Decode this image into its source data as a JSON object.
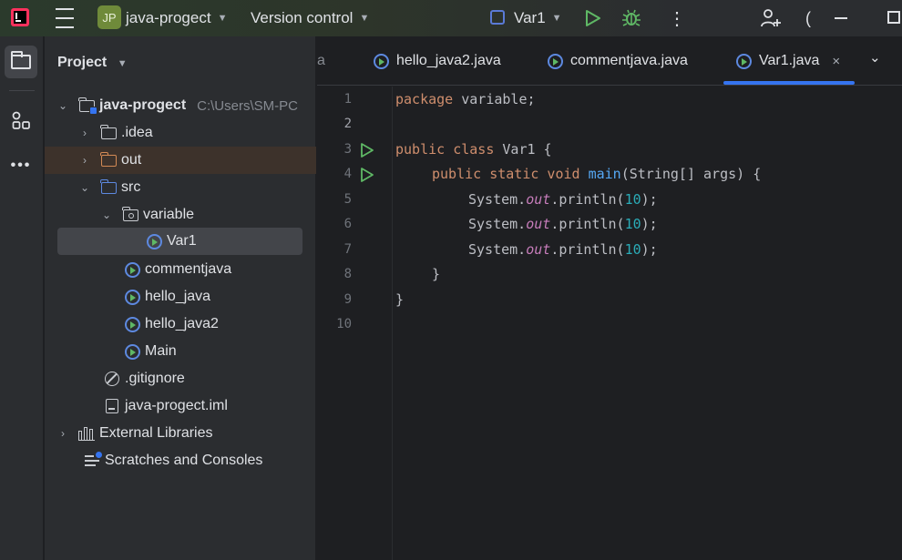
{
  "titlebar": {
    "project_badge": "JP",
    "project_name": "java-progect",
    "vcs_label": "Version control",
    "run_config": "Var1",
    "partial_char": "("
  },
  "project_panel": {
    "title": "Project",
    "tree": [
      {
        "label": "java-progect",
        "hint": "C:\\Users\\SM-PC",
        "arrow": "⌄"
      },
      {
        "label": ".idea",
        "arrow": "›"
      },
      {
        "label": "out",
        "arrow": "›"
      },
      {
        "label": "src",
        "arrow": "⌄"
      },
      {
        "label": "variable",
        "arrow": "⌄"
      },
      {
        "label": "Var1"
      },
      {
        "label": "commentjava"
      },
      {
        "label": "hello_java"
      },
      {
        "label": "hello_java2"
      },
      {
        "label": "Main"
      },
      {
        "label": ".gitignore"
      },
      {
        "label": "java-progect.iml"
      },
      {
        "label": "External Libraries",
        "arrow": "›"
      },
      {
        "label": "Scratches and Consoles"
      }
    ]
  },
  "tabs": {
    "fade_fragment": "a",
    "items": [
      {
        "label": "hello_java2.java"
      },
      {
        "label": "commentjava.java"
      },
      {
        "label": "Var1.java",
        "close": "×"
      }
    ],
    "more": "⌄"
  },
  "editor": {
    "line_numbers": [
      "1",
      "2",
      "3",
      "4",
      "5",
      "6",
      "7",
      "8",
      "9",
      "10"
    ],
    "current_line": 2,
    "lines": {
      "l1": {
        "kw": "package",
        "rest": " variable;"
      },
      "l3": {
        "kw": "public class",
        "rest": " Var1 {"
      },
      "l4": {
        "kw": "public static void",
        "fn": "main",
        "rest": "(String[] args) {"
      },
      "l5": {
        "pre": "System.",
        "st": "out",
        "mid": ".println(",
        "num": "10",
        "end": ");"
      },
      "l6": {
        "pre": "System.",
        "st": "out",
        "mid": ".println(",
        "num": "10",
        "end": ");"
      },
      "l7": {
        "pre": "System.",
        "st": "out",
        "mid": ".println(",
        "num": "10",
        "end": ");"
      },
      "l8": "}",
      "l9": "}"
    }
  },
  "colors": {
    "keyword": "#cf8e6d",
    "function": "#56a8f5",
    "static_field": "#c77dbb",
    "number": "#2aacb8",
    "accent": "#3574f0",
    "run_green": "#5fb865"
  }
}
